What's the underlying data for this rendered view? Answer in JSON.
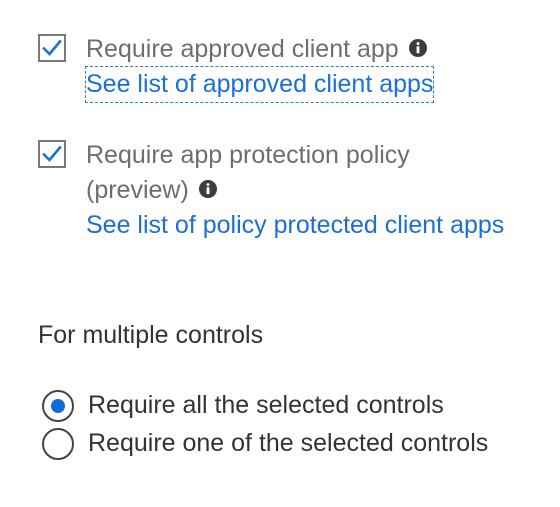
{
  "controls": {
    "approved_app": {
      "checked": true,
      "label": "Require approved client app",
      "info_icon": "info-icon",
      "link": "See list of approved client apps"
    },
    "app_protection": {
      "checked": true,
      "label_line1": "Require app protection policy",
      "label_line2": "(preview)",
      "info_icon": "info-icon",
      "link": "See list of policy protected client apps"
    }
  },
  "multiple_controls": {
    "heading": "For multiple controls",
    "options": [
      {
        "label": "Require all the selected controls",
        "selected": true
      },
      {
        "label": "Require one of the selected controls",
        "selected": false
      }
    ]
  },
  "colors": {
    "link": "#1a6fd8",
    "radio_selected": "#0f6cd4",
    "checkmark": "#1a6fd8",
    "label_gray": "#6e6e6e"
  }
}
